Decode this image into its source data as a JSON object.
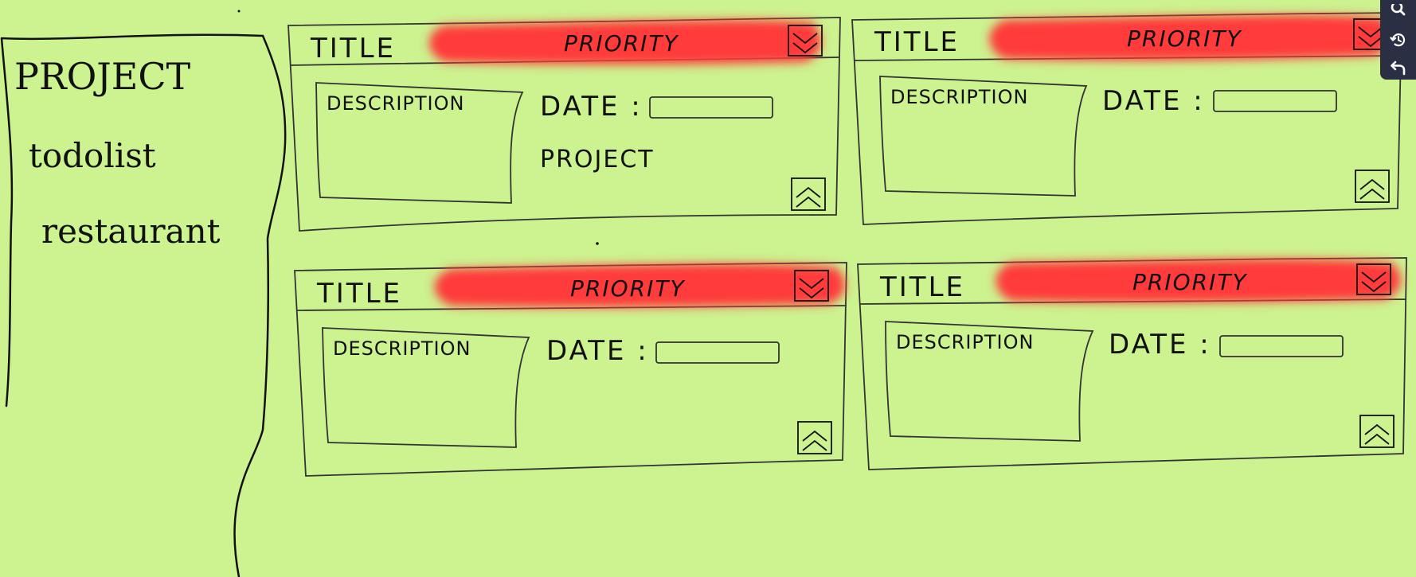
{
  "sidebar": {
    "project_heading": "PROJECT",
    "items": [
      {
        "label": "todolist"
      },
      {
        "label": "restaurant"
      }
    ]
  },
  "cards": [
    {
      "title": "TITLE",
      "priority": "PRIORITY",
      "description": "DESCRIPTION",
      "date_label": "DATE :",
      "project": "PROJECT"
    },
    {
      "title": "TITLE",
      "priority": "PRIORITY",
      "description": "DESCRIPTION",
      "date_label": "DATE :",
      "project": ""
    },
    {
      "title": "TITLE",
      "priority": "PRIORITY",
      "description": "DESCRIPTION",
      "date_label": "DATE :",
      "project": ""
    },
    {
      "title": "TITLE",
      "priority": "PRIORITY",
      "description": "DESCRIPTION",
      "date_label": "DATE :",
      "project": ""
    }
  ],
  "colors": {
    "background": "#cdf290",
    "priority_bar": "#ff3b3b",
    "ink": "#111111",
    "toolbar": "#2a2f43",
    "toolbar_icon": "#ffffff"
  },
  "toolbar": {
    "icons": [
      "search-icon",
      "history-icon",
      "undo-icon"
    ]
  }
}
